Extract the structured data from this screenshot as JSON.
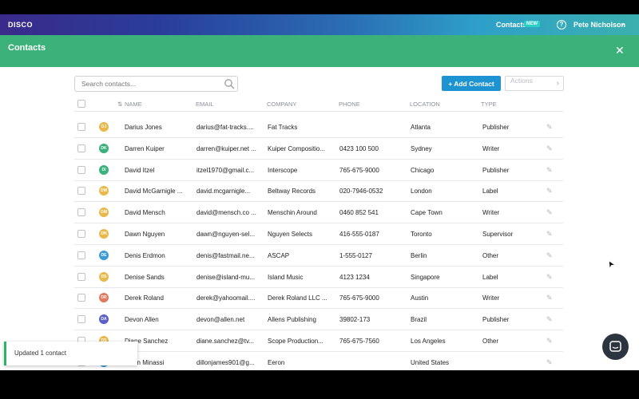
{
  "topbar": {
    "logo": "DISCO",
    "contacts": "Contacts",
    "badge": "NEW",
    "help": "?",
    "user": "Pete Nicholson",
    "caret": "⌄"
  },
  "header": {
    "title": "Contacts",
    "close": "✕"
  },
  "toolbar": {
    "search_placeholder": "Search contacts...",
    "add_label": "+ Add Contact",
    "actions_label": "Actions",
    "actions_chevron": "›"
  },
  "table": {
    "columns": {
      "name": "Name",
      "email": "Email",
      "company": "Company",
      "phone": "Phone",
      "location": "Location",
      "type": "Type",
      "sort_icon": "⇅"
    },
    "rows": [
      {
        "initials": "DJ",
        "color": "#e8b84b",
        "name": "Darius Jones",
        "email": "darius@fat-tracks....",
        "company": "Fat Tracks",
        "phone": "",
        "location": "Atlanta",
        "type": "Publisher"
      },
      {
        "initials": "DK",
        "color": "#3ab07a",
        "name": "Darren Kuiper",
        "email": "darren@kuiper.net ...",
        "company": "Kuiper Compositio...",
        "phone": "0423 100 500",
        "location": "Sydney",
        "type": "Writer"
      },
      {
        "initials": "DI",
        "color": "#3ab07a",
        "name": "David Itzel",
        "email": "itzel1970@gmail.c...",
        "company": "Interscope",
        "phone": "765-675-9000",
        "location": "Chicago",
        "type": "Publisher"
      },
      {
        "initials": "DM",
        "color": "#e8b84b",
        "name": "David McGarnigle ...",
        "email": "david.mcgarnigle...",
        "company": "Beltway Records",
        "phone": "020-7946-0532",
        "location": "London",
        "type": "Label"
      },
      {
        "initials": "DM",
        "color": "#e8b84b",
        "name": "David Mensch",
        "email": "david@mensch.co ...",
        "company": "Menschin Around",
        "phone": "0460 852 541",
        "location": "Cape Town",
        "type": "Writer"
      },
      {
        "initials": "DN",
        "color": "#e8b84b",
        "name": "Dawn Nguyen",
        "email": "dawn@nguyen-sel...",
        "company": "Nguyen Selects",
        "phone": "416-555-0187",
        "location": "Toronto",
        "type": "Supervisor"
      },
      {
        "initials": "DE",
        "color": "#3b9ad6",
        "name": "Denis Erdmon",
        "email": "denis@fastmail.ne...",
        "company": "ASCAP",
        "phone": "1-555-0127",
        "location": "Berlin",
        "type": "Other"
      },
      {
        "initials": "DS",
        "color": "#e8b84b",
        "name": "Denise Sands",
        "email": "denise@island-mu...",
        "company": "Island Music",
        "phone": "4123 1234",
        "location": "Singapore",
        "type": "Label"
      },
      {
        "initials": "DR",
        "color": "#e07a5f",
        "name": "Derek Roland",
        "email": "derek@yahoomail....",
        "company": "Derek Roland LLC ...",
        "phone": "765-675-9000",
        "location": "Austin",
        "type": "Writer"
      },
      {
        "initials": "DA",
        "color": "#5b5fc7",
        "name": "Devon Allen",
        "email": "devon@allen.net",
        "company": "Allens Publishing",
        "phone": "39802-173",
        "location": "Brazil",
        "type": "Publisher"
      },
      {
        "initials": "DS",
        "color": "#e8b84b",
        "name": "Diane Sanchez",
        "email": "diane.sanchez@tv...",
        "company": "Scope Production...",
        "phone": "765-675-7560",
        "location": "Los Angeles",
        "type": "Other"
      },
      {
        "initials": "DM",
        "color": "#3b9ad6",
        "name": "Dillon Minassi",
        "email": "dillonjames901@g...",
        "company": "Eeron",
        "phone": "",
        "location": "United States",
        "type": ""
      }
    ]
  },
  "toast": {
    "message": "Updated 1 contact"
  },
  "icons": {
    "edit": "✎",
    "cursor": "➤"
  }
}
